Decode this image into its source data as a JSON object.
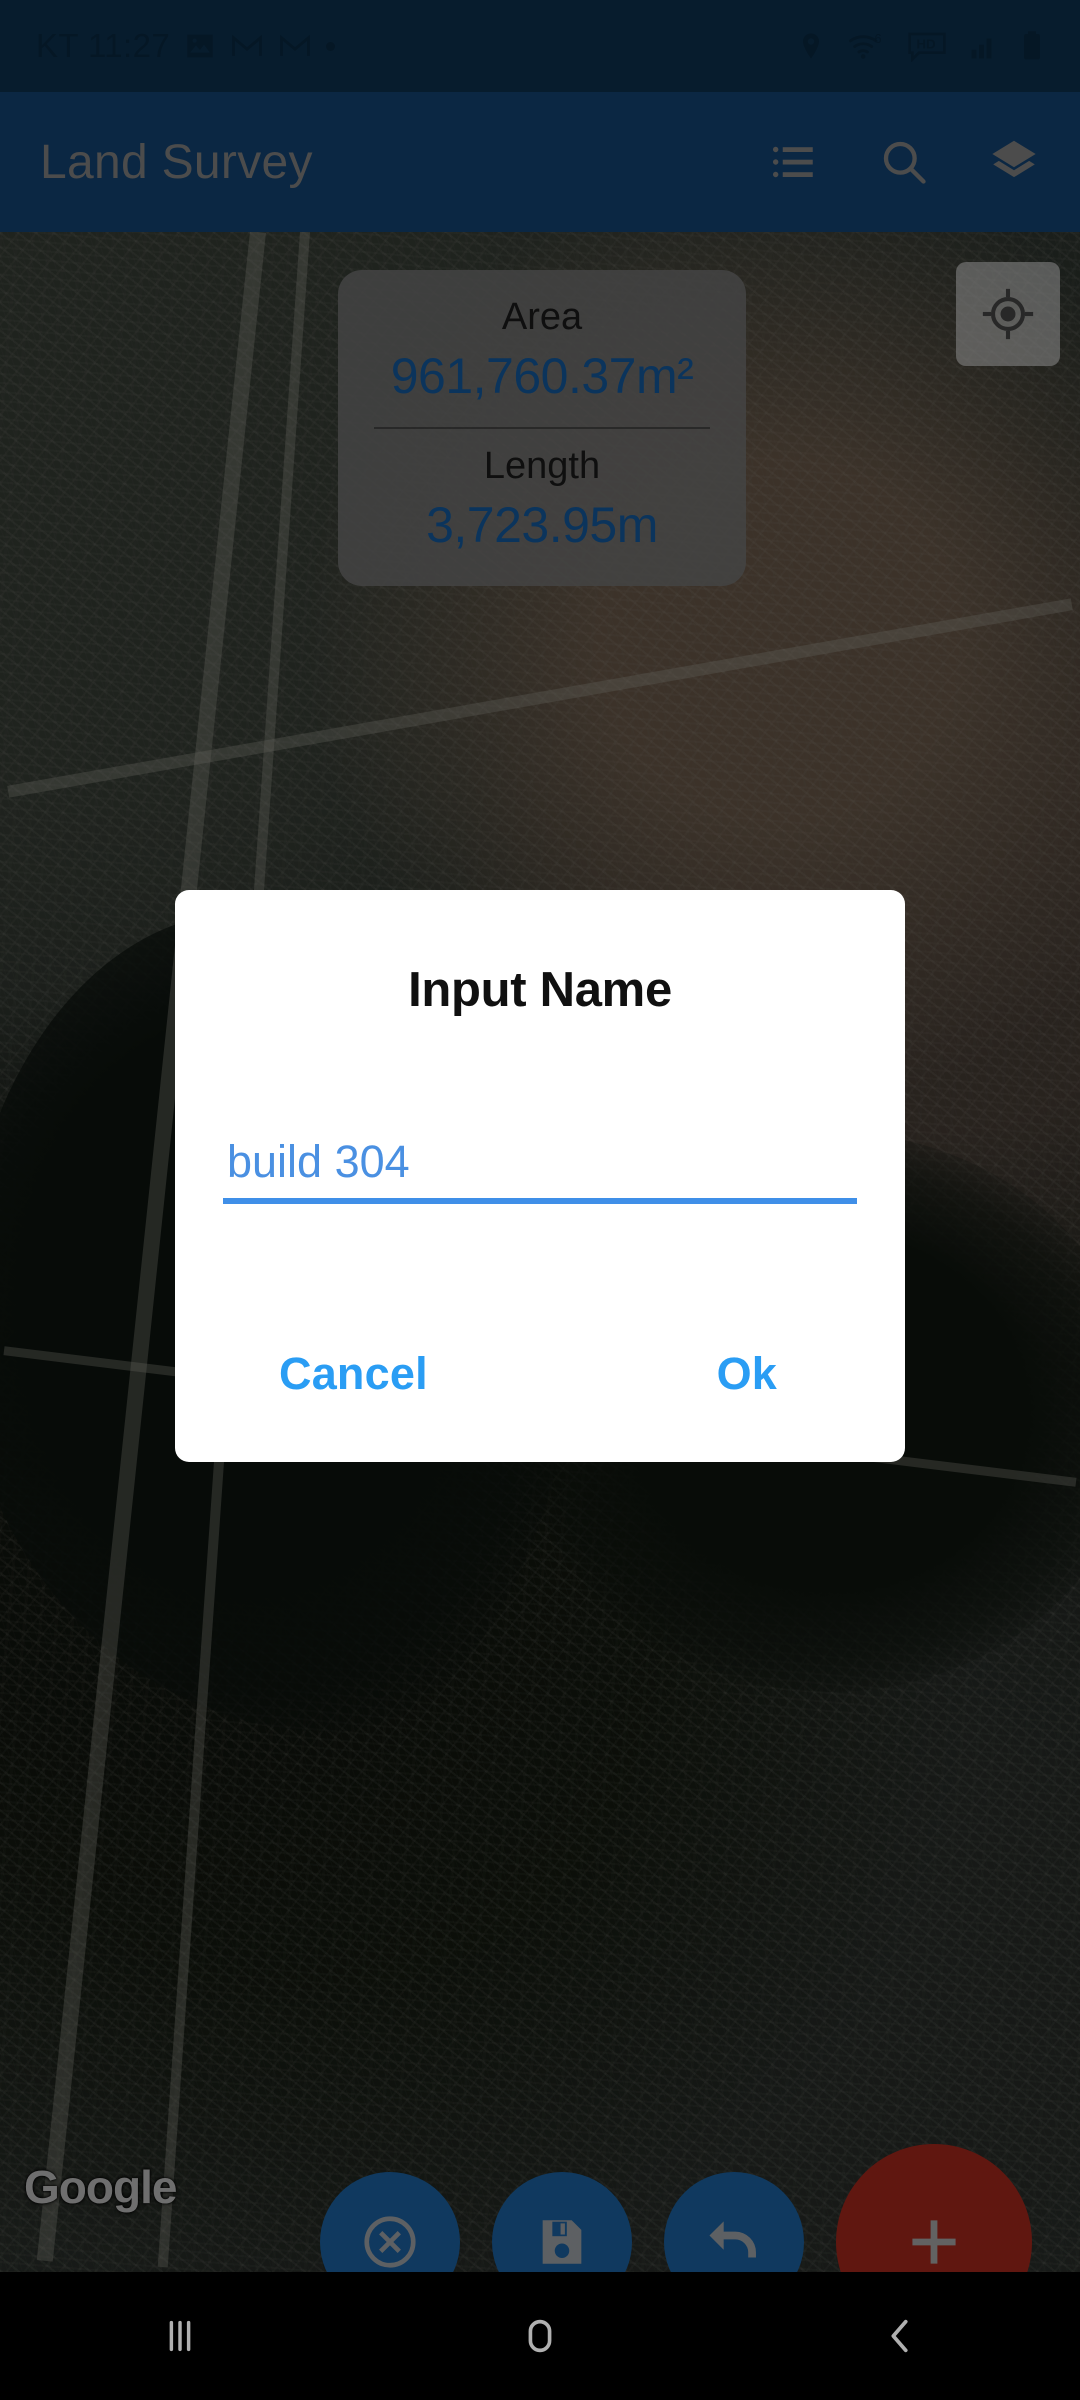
{
  "status_bar": {
    "carrier_and_time": "KT 11:27",
    "left_icons": [
      "image-icon",
      "gmail-icon",
      "gmail-icon",
      "dot-icon"
    ],
    "right_icons": [
      "location-pin-icon",
      "wifi-6-icon",
      "hd-icon",
      "signal-bars-icon",
      "battery-icon"
    ],
    "background_color": "#0d3352"
  },
  "app_bar": {
    "title": "Land Survey",
    "background_color": "#14487b",
    "actions": [
      {
        "name": "list-icon",
        "label": "List"
      },
      {
        "name": "search-icon",
        "label": "Search"
      },
      {
        "name": "layers-icon",
        "label": "Layers"
      }
    ]
  },
  "map": {
    "type": "satellite",
    "watermark": "Google",
    "my_location_button": "my-location-icon",
    "polygon": {
      "stroke_color": "#cc2015",
      "fill_color": "rgba(190,30,20,0.35)"
    }
  },
  "info_card": {
    "area_label": "Area",
    "area_value": "961,760.37m²",
    "length_label": "Length",
    "length_value": "3,723.95m",
    "value_color": "#1560a8",
    "background_color": "rgba(124,124,124,0.86)"
  },
  "dialog": {
    "title": "Input Name",
    "input_value": "build 304",
    "input_placeholder": "",
    "cancel_label": "Cancel",
    "ok_label": "Ok",
    "accent_color": "#2a9df4"
  },
  "fabs": [
    {
      "name": "cancel-fab",
      "icon": "cancel-circle-icon",
      "color": "#1e69ad"
    },
    {
      "name": "save-fab",
      "icon": "save-floppy-icon",
      "color": "#1e69ad"
    },
    {
      "name": "undo-fab",
      "icon": "undo-arrow-icon",
      "color": "#1e69ad"
    },
    {
      "name": "add-fab",
      "icon": "plus-icon",
      "color": "#b02a1e"
    }
  ],
  "nav_bar": {
    "recents_label": "Recents",
    "home_label": "Home",
    "back_label": "Back"
  }
}
